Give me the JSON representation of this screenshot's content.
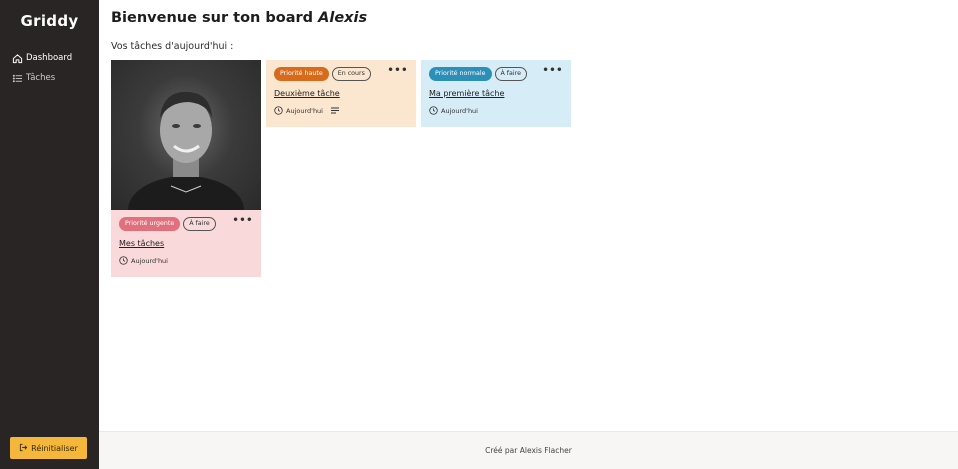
{
  "sidebar": {
    "logo": "Griddy",
    "items": [
      {
        "label": "Dashboard",
        "icon": "home-icon",
        "active": true
      },
      {
        "label": "Tâches",
        "icon": "list-icon",
        "active": false
      }
    ],
    "reset_label": "Réinitialiser",
    "reset_color": "#f5b73b"
  },
  "header": {
    "title_prefix": "Bienvenue sur ton board",
    "user_name": "Alexis",
    "subtitle": "Vos tâches d'aujourd'hui :"
  },
  "cards": [
    {
      "has_photo": true,
      "priority": "Priorité urgente",
      "priority_color": "#e0707c",
      "status": "À faire",
      "title": "Mes tâches",
      "date": "Aujourd'hui",
      "bg": "#f9d9d9"
    },
    {
      "has_photo": false,
      "priority": "Priorité haute",
      "priority_color": "#d76b1b",
      "status": "En cours",
      "title": "Deuxième tâche",
      "date": "Aujourd'hui",
      "has_description": true,
      "bg": "#fbe6cf"
    },
    {
      "has_photo": false,
      "priority": "Priorité normale",
      "priority_color": "#2b8fb8",
      "status": "À faire",
      "title": "Ma première tâche",
      "date": "Aujourd'hui",
      "bg": "#d6ecf6"
    }
  ],
  "footer": {
    "text": "Créé par Alexis Flacher"
  }
}
